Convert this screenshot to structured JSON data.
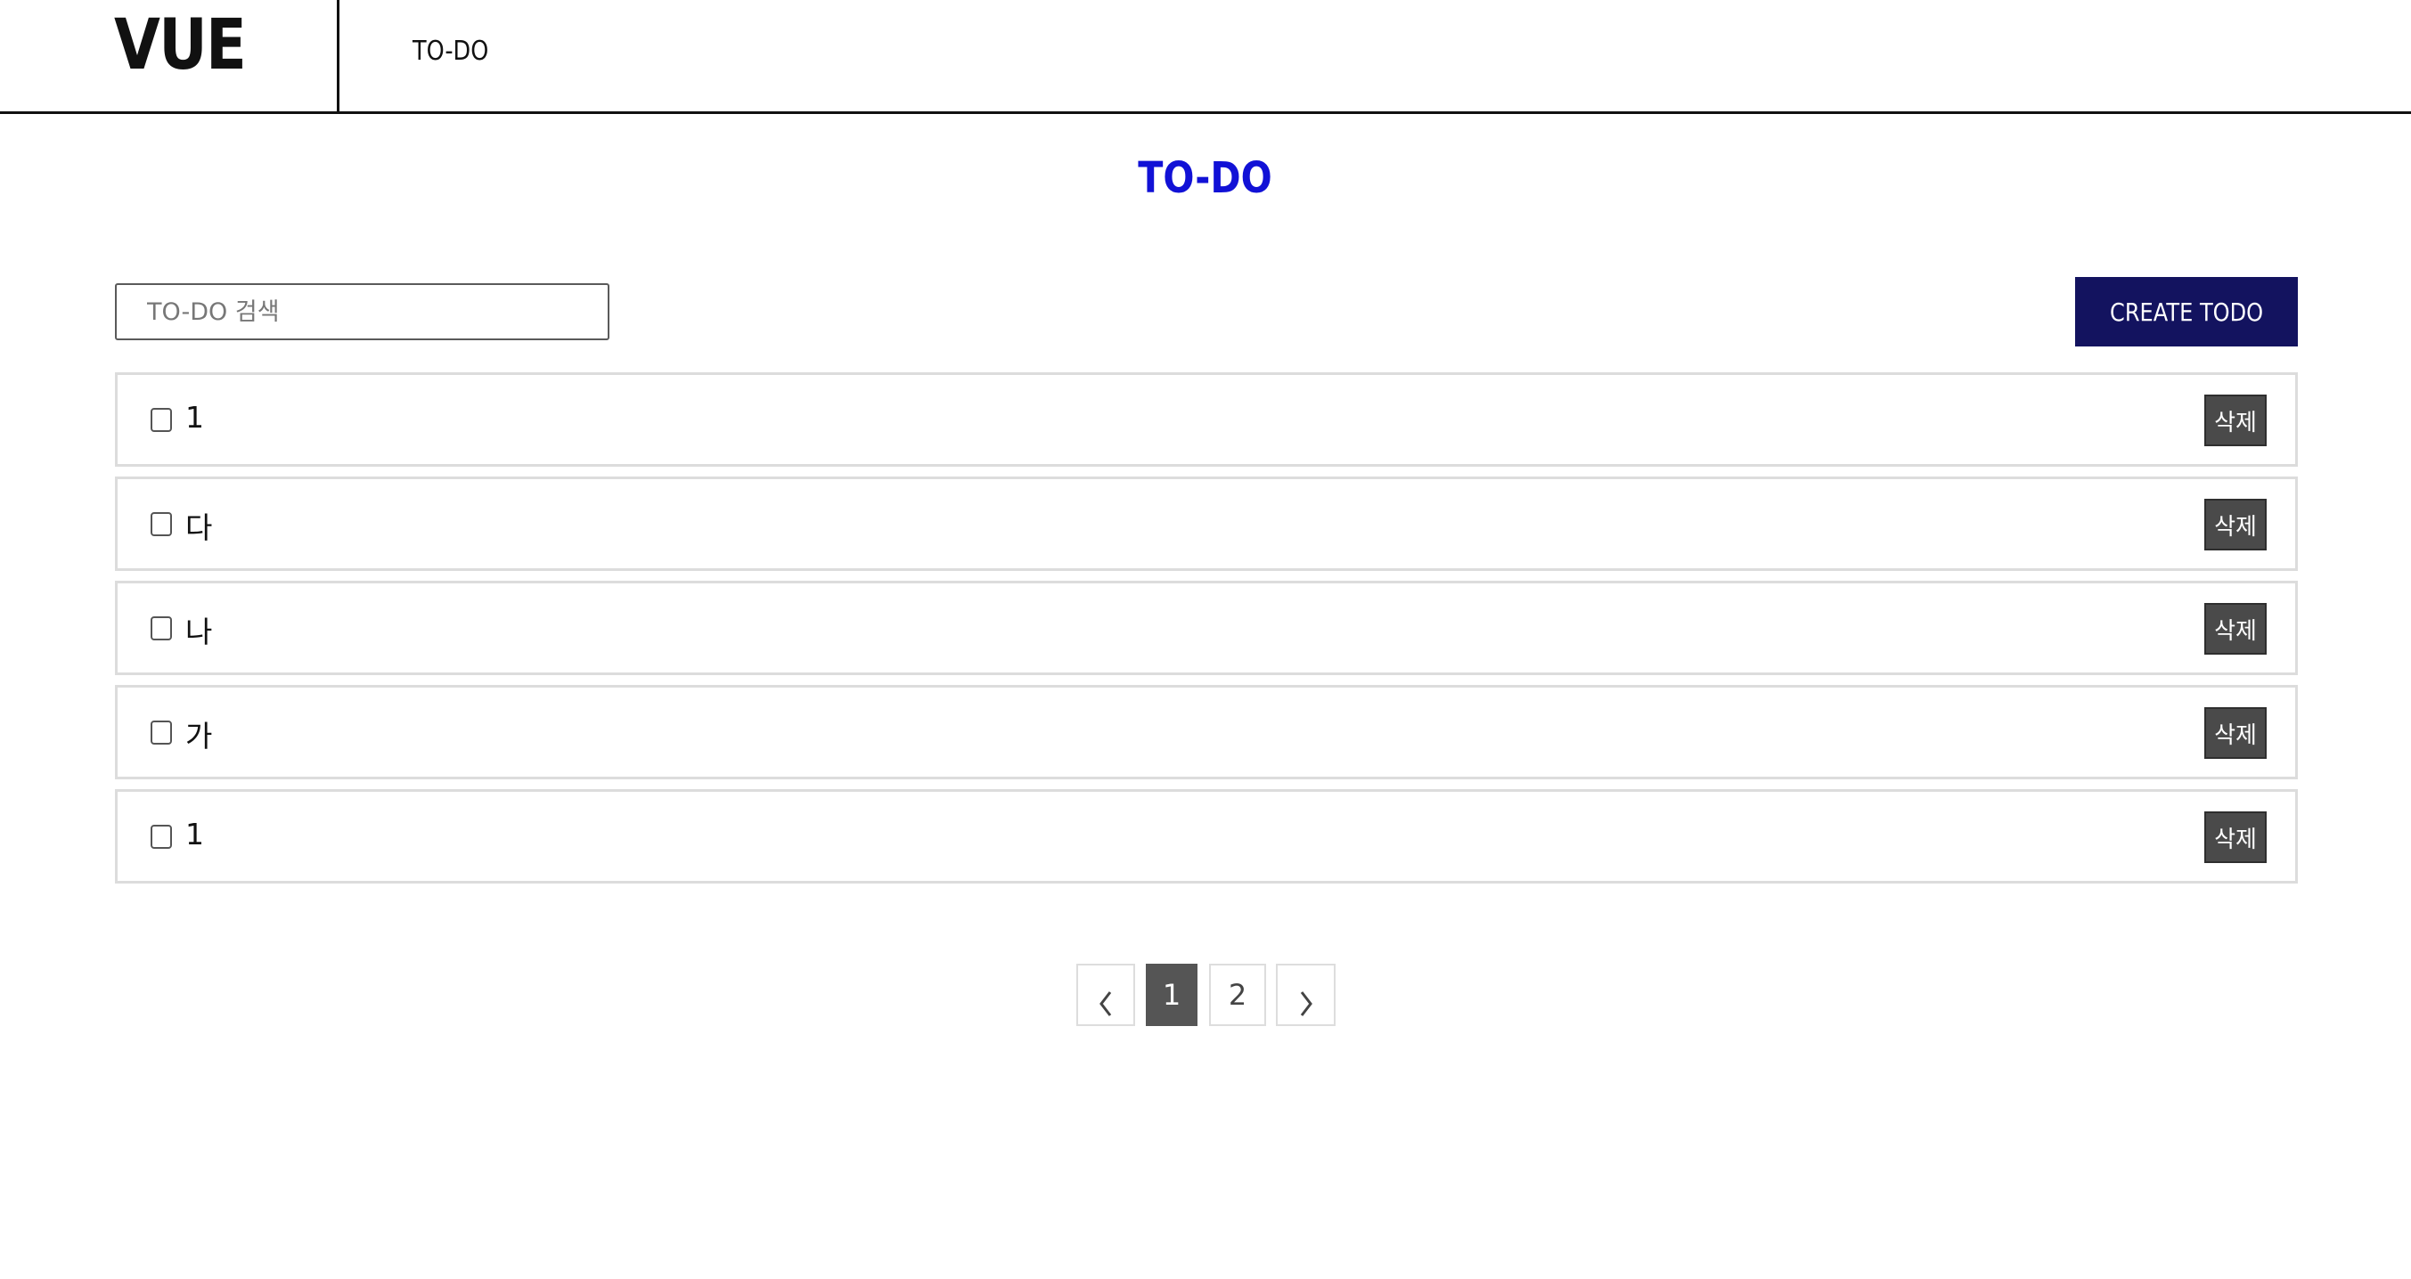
{
  "header": {
    "logo": "VUE",
    "nav": [
      {
        "label": "TO-DO"
      }
    ]
  },
  "main": {
    "title": "TO-DO",
    "search": {
      "placeholder": "TO-DO 검색",
      "value": ""
    },
    "create_label": "CREATE TODO",
    "todos": [
      {
        "text": "1",
        "checked": false,
        "delete_label": "삭제"
      },
      {
        "text": "다",
        "checked": false,
        "delete_label": "삭제"
      },
      {
        "text": "나",
        "checked": false,
        "delete_label": "삭제"
      },
      {
        "text": "가",
        "checked": false,
        "delete_label": "삭제"
      },
      {
        "text": "1",
        "checked": false,
        "delete_label": "삭제"
      }
    ]
  },
  "pagination": {
    "prev_icon": "chevron-left-icon",
    "next_icon": "chevron-right-icon",
    "pages": [
      "1",
      "2"
    ],
    "current": "1"
  },
  "colors": {
    "title": "#1111d6",
    "create_button": "#13135f",
    "delete_button": "#4a4a4a",
    "active_page": "#555555"
  }
}
